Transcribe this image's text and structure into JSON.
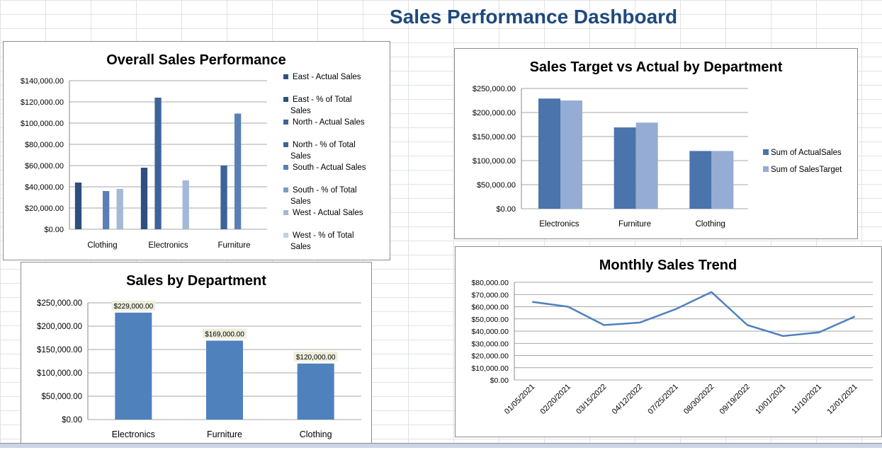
{
  "title": "Sales Performance Dashboard",
  "colors": {
    "east": "#2f4f7f",
    "north": "#3e629a",
    "south": "#5a7fb5",
    "south_pct": "#7d9bc8",
    "west": "#a4b8d8",
    "west_pct": "#c3cfe5",
    "actual": "#4a74ab",
    "target": "#95acd4",
    "bar": "#4f81bd",
    "line": "#4f81bd",
    "title": "#1f497d",
    "label_bg": "#eeeedd"
  },
  "chart_data": [
    {
      "type": "bar",
      "title": "Overall Sales Performance",
      "categories": [
        "Clothing",
        "Electronics",
        "Furniture"
      ],
      "ylim": [
        0,
        140000
      ],
      "yticks": [
        "$0.00",
        "$20,000.00",
        "$40,000.00",
        "$60,000.00",
        "$80,000.00",
        "$100,000.00",
        "$120,000.00",
        "$140,000.00"
      ],
      "legend_position": "right",
      "grid": true,
      "series": [
        {
          "name": "East  - Actual Sales",
          "values": [
            44000,
            58000,
            null
          ]
        },
        {
          "name": "East  - % of Total Sales",
          "values": [
            null,
            null,
            null
          ]
        },
        {
          "name": "North  - Actual Sales",
          "values": [
            null,
            124000,
            60000
          ]
        },
        {
          "name": "North  - % of Total Sales",
          "values": [
            null,
            null,
            null
          ]
        },
        {
          "name": "South  - Actual Sales",
          "values": [
            36000,
            null,
            109000
          ]
        },
        {
          "name": "South  - % of Total Sales",
          "values": [
            null,
            null,
            null
          ]
        },
        {
          "name": "West  - Actual Sales",
          "values": [
            38000,
            46000,
            null
          ]
        },
        {
          "name": "West  - % of Total Sales",
          "values": [
            null,
            null,
            null
          ]
        }
      ]
    },
    {
      "type": "bar",
      "title": "Sales Target vs Actual by Department",
      "categories": [
        "Electronics",
        "Furniture",
        "Clothing"
      ],
      "ylim": [
        0,
        250000
      ],
      "yticks": [
        "$0.00",
        "$50,000.00",
        "$100,000.00",
        "$150,000.00",
        "$200,000.00",
        "$250,000.00"
      ],
      "legend_position": "right",
      "grid": true,
      "series": [
        {
          "name": "Sum of  ActualSales",
          "values": [
            229000,
            169000,
            120000
          ]
        },
        {
          "name": "Sum of  SalesTarget",
          "values": [
            225000,
            179000,
            120000
          ]
        }
      ]
    },
    {
      "type": "bar",
      "title": "Sales by  Department",
      "categories": [
        "Electronics",
        "Furniture",
        "Clothing"
      ],
      "values": [
        229000,
        169000,
        120000
      ],
      "data_labels": [
        "$229,000.00",
        "$169,000.00",
        "$120,000.00"
      ],
      "ylim": [
        0,
        250000
      ],
      "yticks": [
        "$0.00",
        "$50,000.00",
        "$100,000.00",
        "$150,000.00",
        "$200,000.00",
        "$250,000.00"
      ],
      "grid": true
    },
    {
      "type": "line",
      "title": "Monthly Sales Trend",
      "x": [
        "01/05/2021",
        "02/20/2021",
        "03/15/2022",
        "04/12/2022",
        "07/25/2021",
        "08/30/2022",
        "09/19/2022",
        "10/01/2021",
        "11/10/2021",
        "12/01/2021"
      ],
      "values": [
        64000,
        60000,
        45000,
        47000,
        58000,
        72000,
        45000,
        36000,
        39000,
        52000
      ],
      "ylim": [
        0,
        80000
      ],
      "yticks": [
        "$0.00",
        "$10,000.00",
        "$20,000.00",
        "$30,000.00",
        "$40,000.00",
        "$50,000.00",
        "$60,000.00",
        "$70,000.00",
        "$80,000.00"
      ],
      "grid": true
    }
  ]
}
